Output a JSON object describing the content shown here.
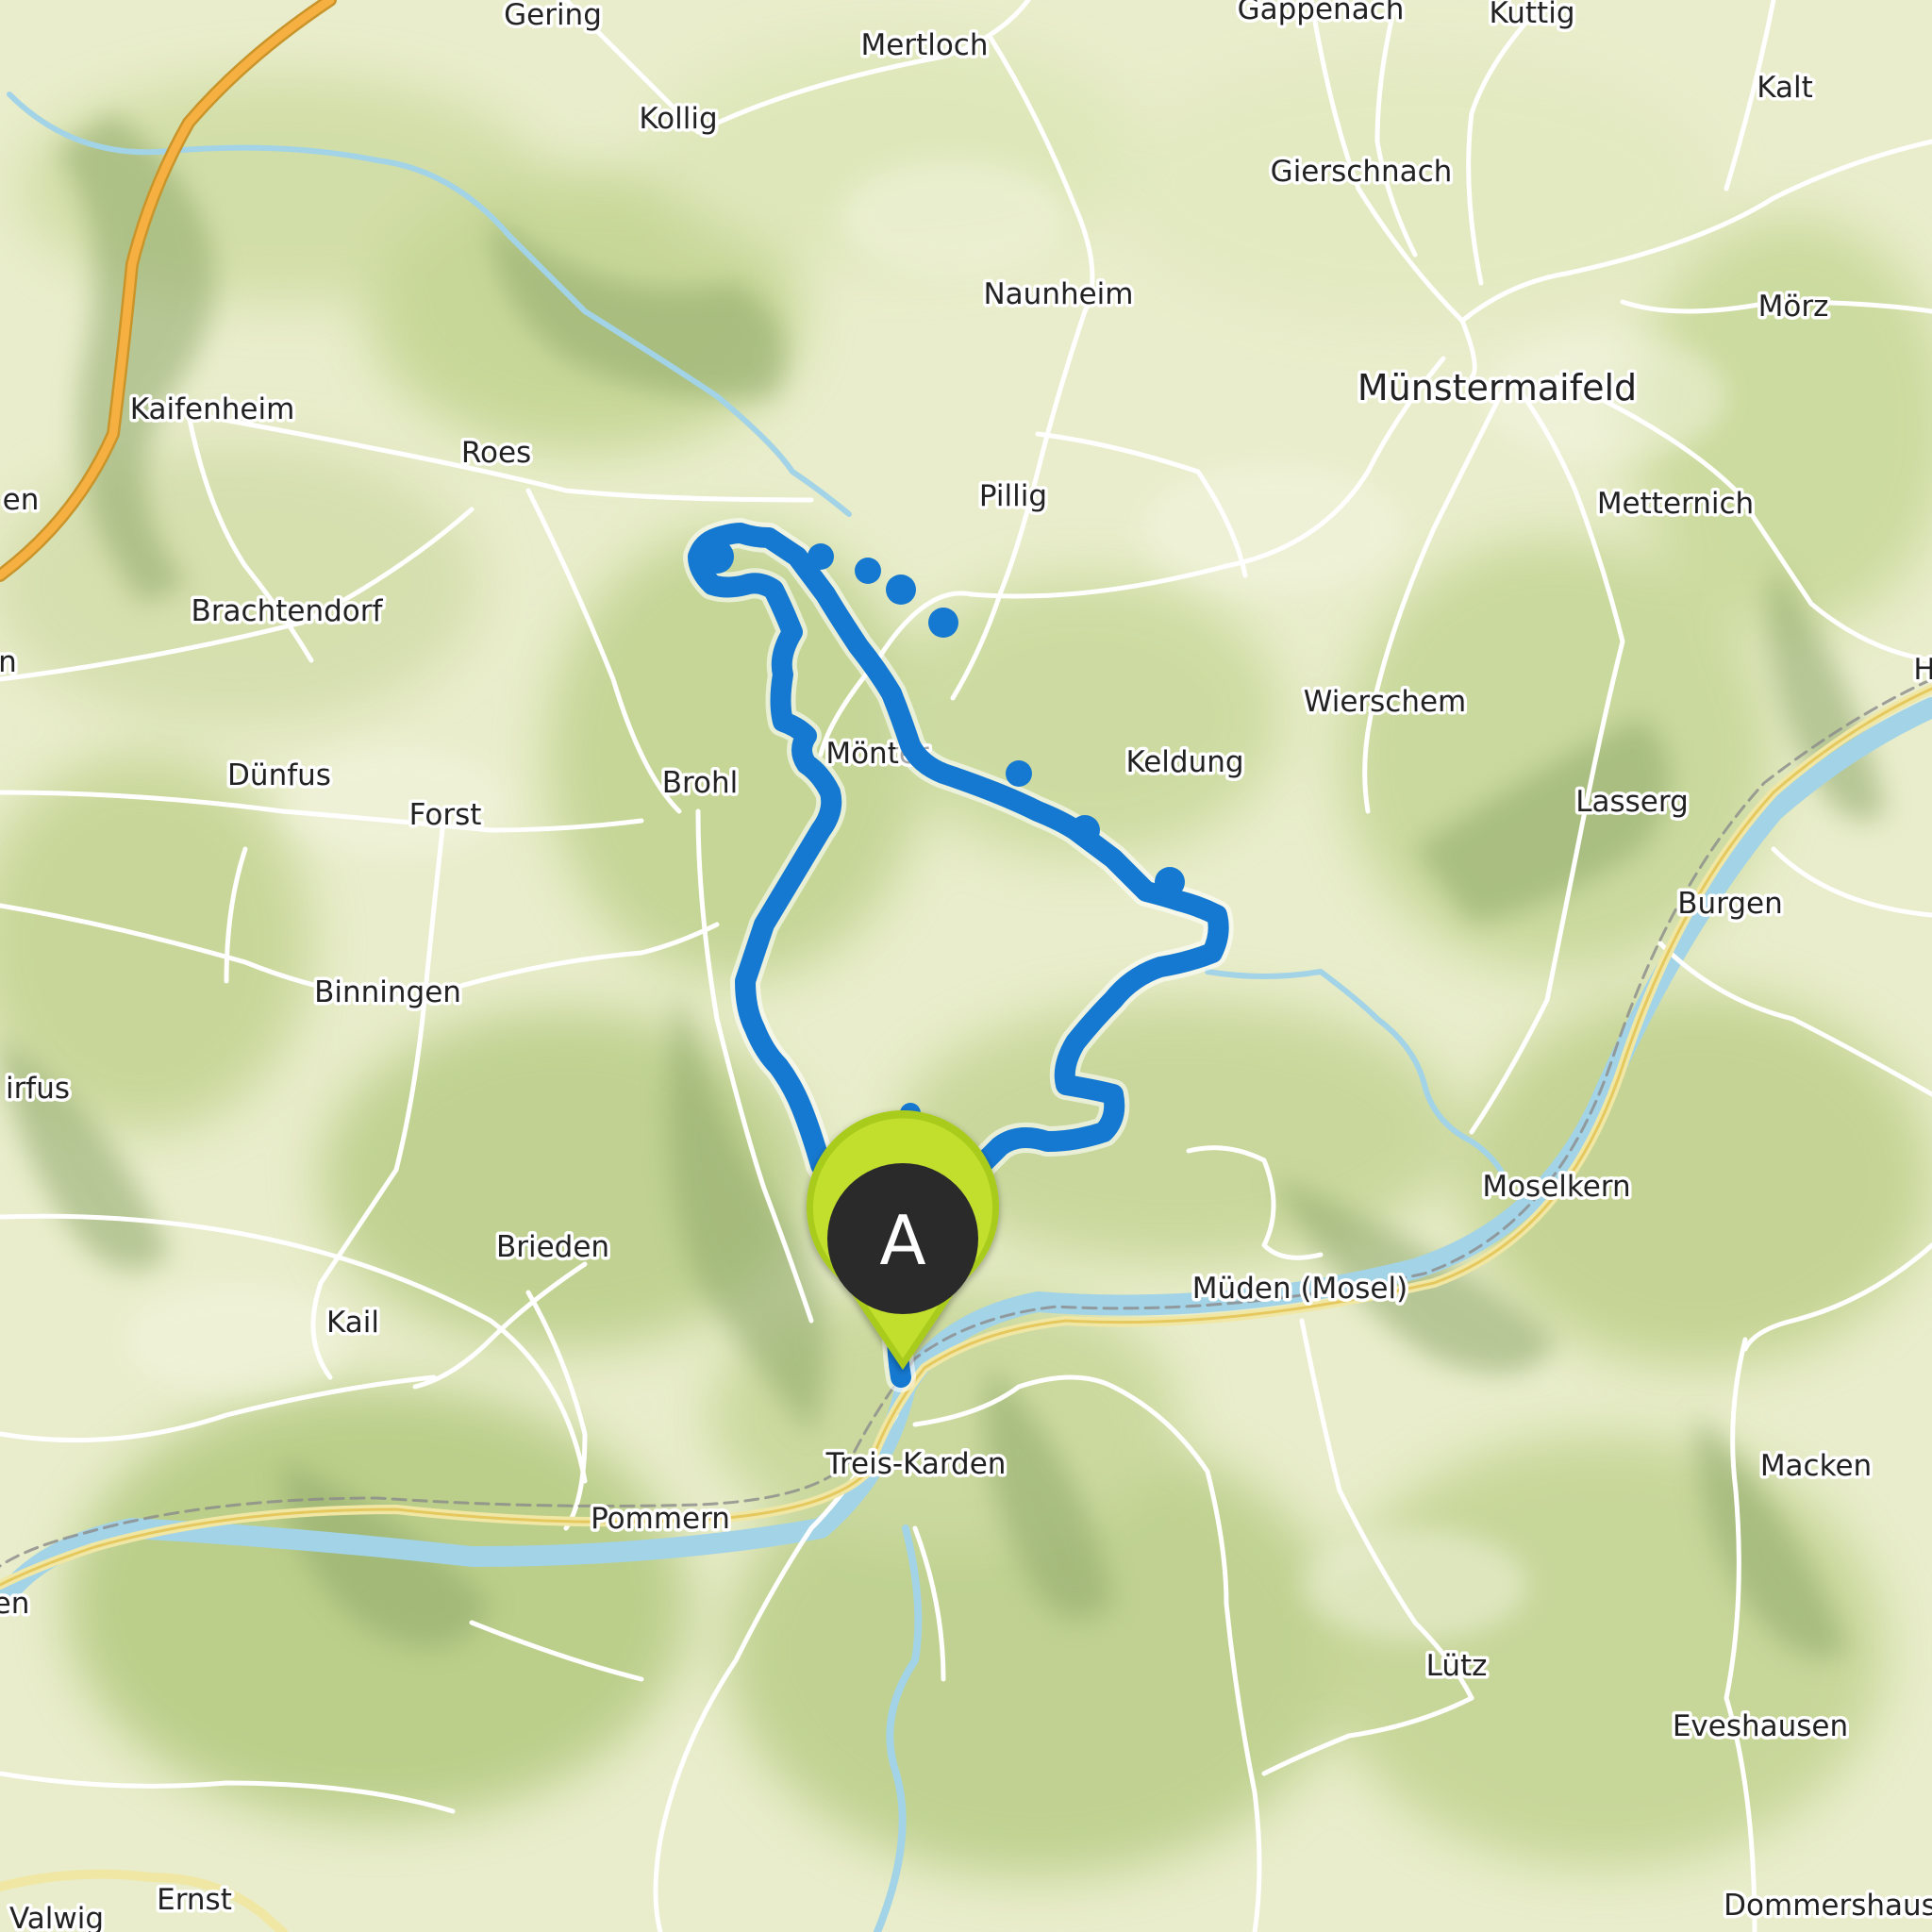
{
  "map": {
    "places": [
      {
        "id": "gering",
        "name": "Gering"
      },
      {
        "id": "mertloch",
        "name": "Mertloch"
      },
      {
        "id": "gappenach",
        "name": "Gappenach"
      },
      {
        "id": "kuttig",
        "name": "Kuttig"
      },
      {
        "id": "kollig",
        "name": "Kollig"
      },
      {
        "id": "kalt",
        "name": "Kalt"
      },
      {
        "id": "gierschnach",
        "name": "Gierschnach"
      },
      {
        "id": "naunheim",
        "name": "Naunheim"
      },
      {
        "id": "moerz",
        "name": "Mörz"
      },
      {
        "id": "kaifenheim",
        "name": "Kaifenheim"
      },
      {
        "id": "muenstermaifeld",
        "name": "Münstermaifeld"
      },
      {
        "id": "roes",
        "name": "Roes"
      },
      {
        "id": "en-left",
        "name": "en"
      },
      {
        "id": "pillig",
        "name": "Pillig"
      },
      {
        "id": "metternich",
        "name": "Metternich"
      },
      {
        "id": "brachtendorf",
        "name": "Brachtendorf"
      },
      {
        "id": "n-left",
        "name": "n"
      },
      {
        "id": "h-right",
        "name": "H"
      },
      {
        "id": "wierschem",
        "name": "Wierschem"
      },
      {
        "id": "moenter",
        "name": "Mönter"
      },
      {
        "id": "keldung",
        "name": "Keldung"
      },
      {
        "id": "duenfus",
        "name": "Dünfus"
      },
      {
        "id": "brohl",
        "name": "Brohl"
      },
      {
        "id": "forst",
        "name": "Forst"
      },
      {
        "id": "lasserg",
        "name": "Lasserg"
      },
      {
        "id": "burgen",
        "name": "Burgen"
      },
      {
        "id": "binningen",
        "name": "Binningen"
      },
      {
        "id": "zirfus",
        "name": "irfus"
      },
      {
        "id": "moselkern",
        "name": "Moselkern"
      },
      {
        "id": "brieden",
        "name": "Brieden"
      },
      {
        "id": "mueden",
        "name": "Müden (Mosel)"
      },
      {
        "id": "kail",
        "name": "Kail"
      },
      {
        "id": "treis-karden",
        "name": "Treis-Karden"
      },
      {
        "id": "macken",
        "name": "Macken"
      },
      {
        "id": "pommern",
        "name": "Pommern"
      },
      {
        "id": "en-bottom",
        "name": "en"
      },
      {
        "id": "luetz",
        "name": "Lütz"
      },
      {
        "id": "eveshausen",
        "name": "Eveshausen"
      },
      {
        "id": "ernst",
        "name": "Ernst"
      },
      {
        "id": "valwig",
        "name": "Valwig"
      },
      {
        "id": "dommershausen",
        "name": "Dommershaus"
      }
    ],
    "start_marker": {
      "label": "A"
    },
    "colors": {
      "route": "#1679d1",
      "marker_ring": "#a9cc1a",
      "marker_fill": "#2b2b2b",
      "river": "#a3d3e6",
      "highway": "#f5b041",
      "main_road": "#f1e7a5",
      "road": "#ffffff"
    }
  }
}
